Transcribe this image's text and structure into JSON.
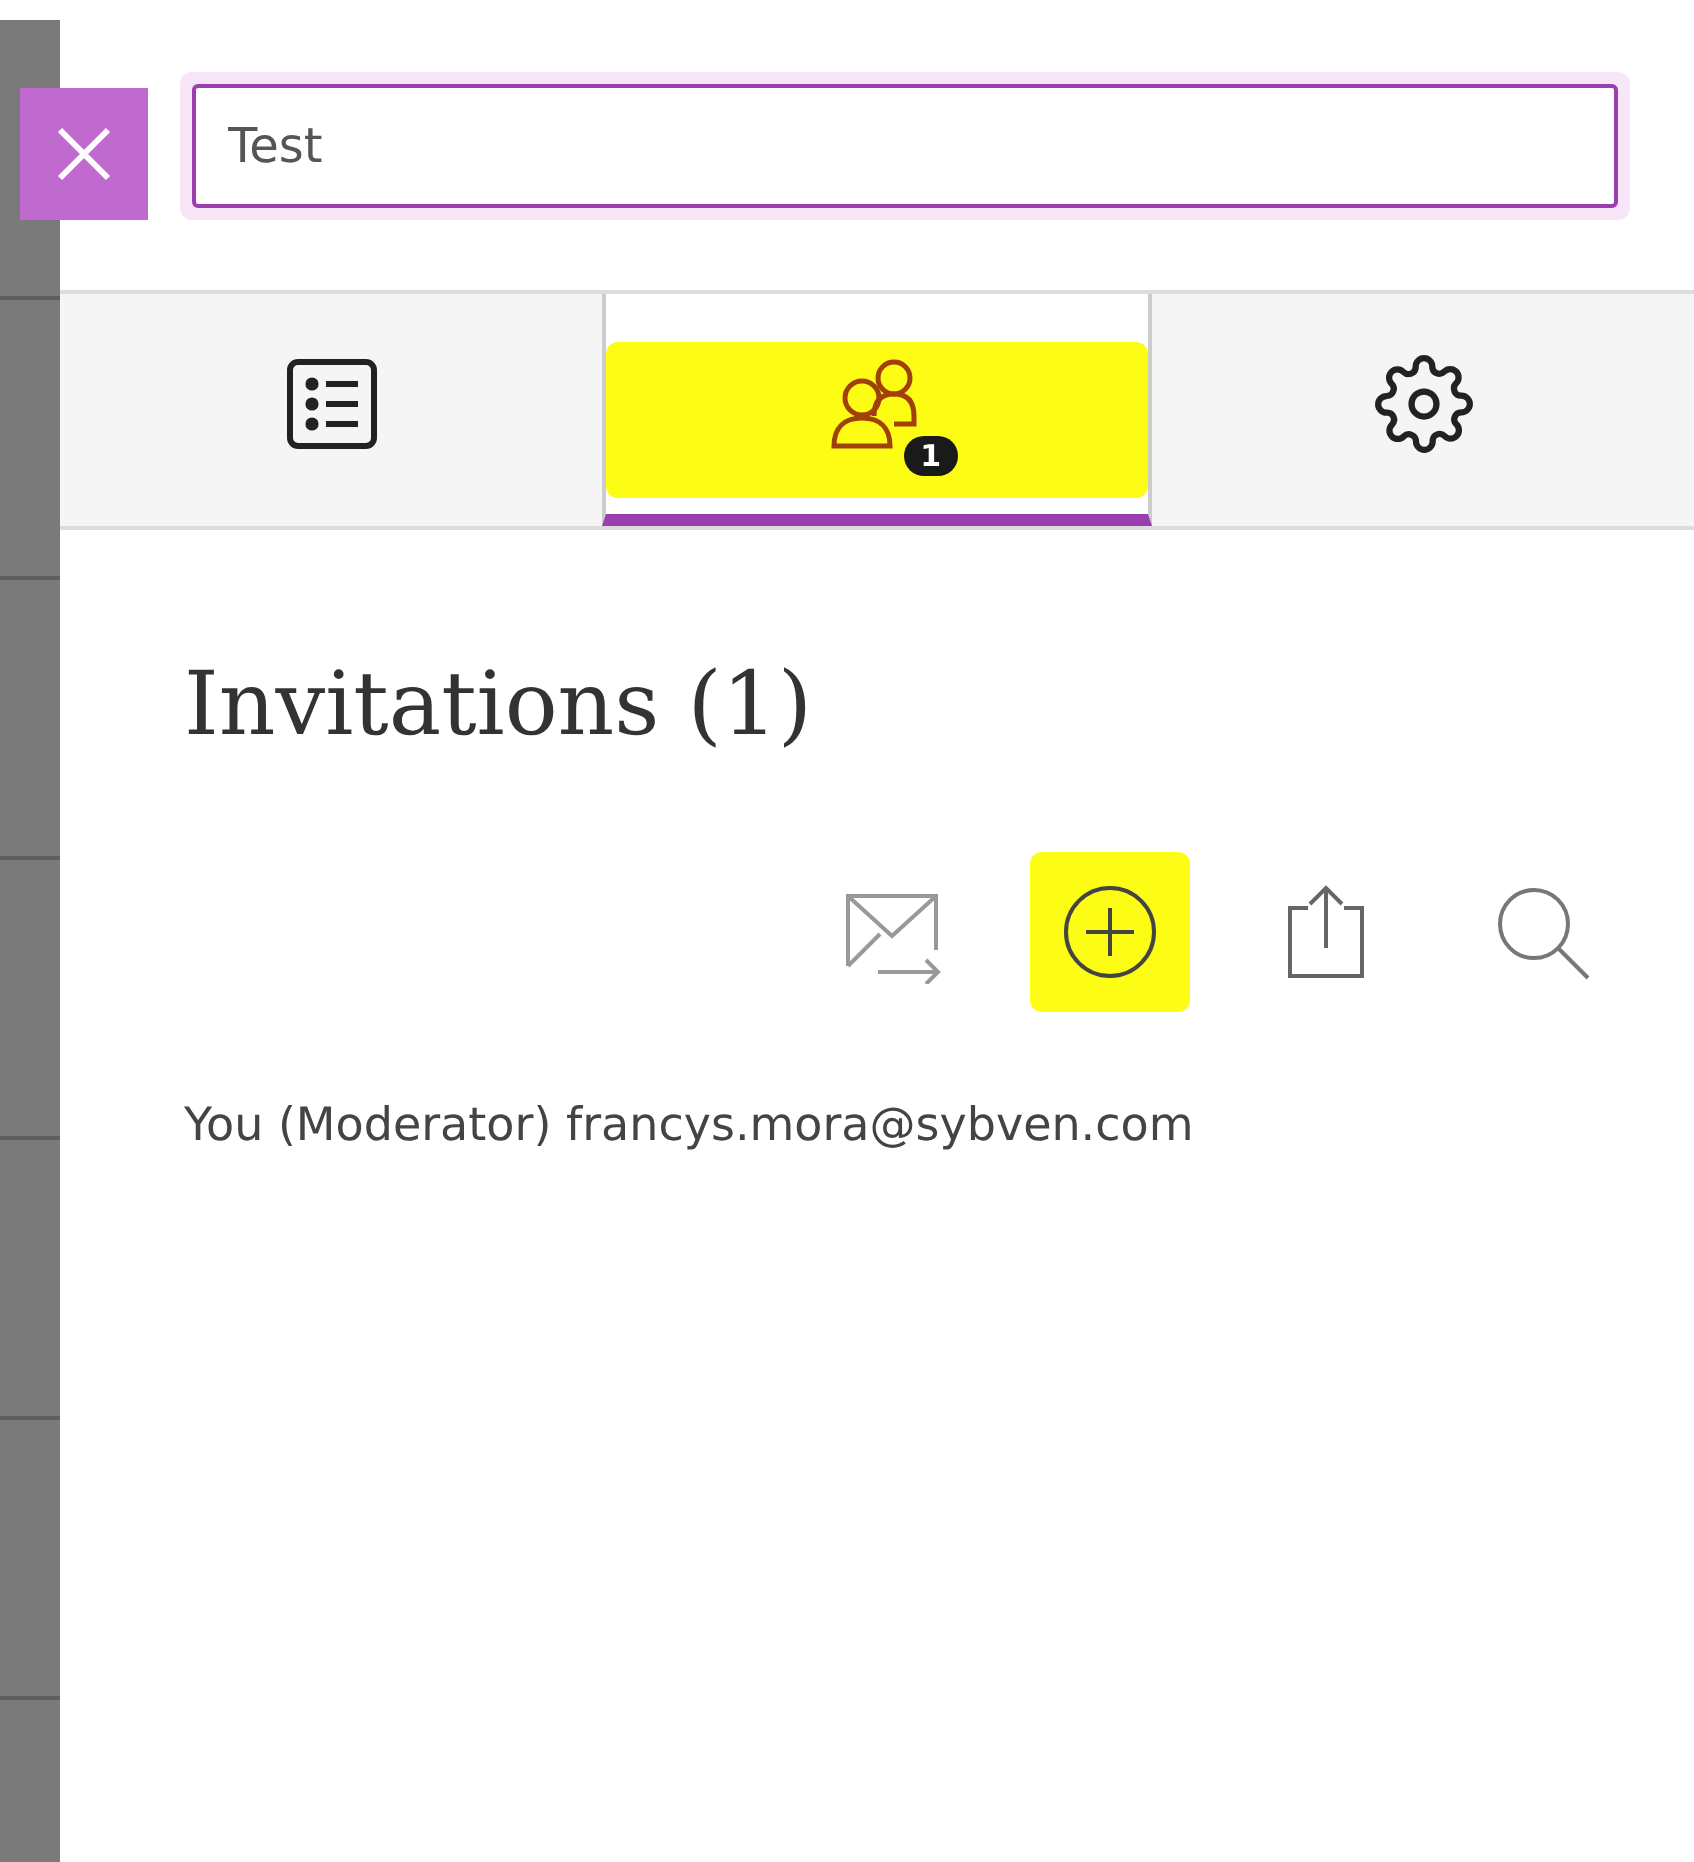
{
  "search": {
    "value": "Test"
  },
  "tabs": [
    {
      "kind": "list",
      "selected": false,
      "highlighted": false
    },
    {
      "kind": "people",
      "selected": true,
      "highlighted": true,
      "badge": "1"
    },
    {
      "kind": "settings",
      "selected": false,
      "highlighted": false
    }
  ],
  "heading": "Invitations (1)",
  "actions": [
    {
      "kind": "mail",
      "highlighted": false
    },
    {
      "kind": "add",
      "highlighted": true
    },
    {
      "kind": "share",
      "highlighted": false
    },
    {
      "kind": "search",
      "highlighted": false
    }
  ],
  "attendee": "You (Moderator) francys.mora@sybven.com"
}
